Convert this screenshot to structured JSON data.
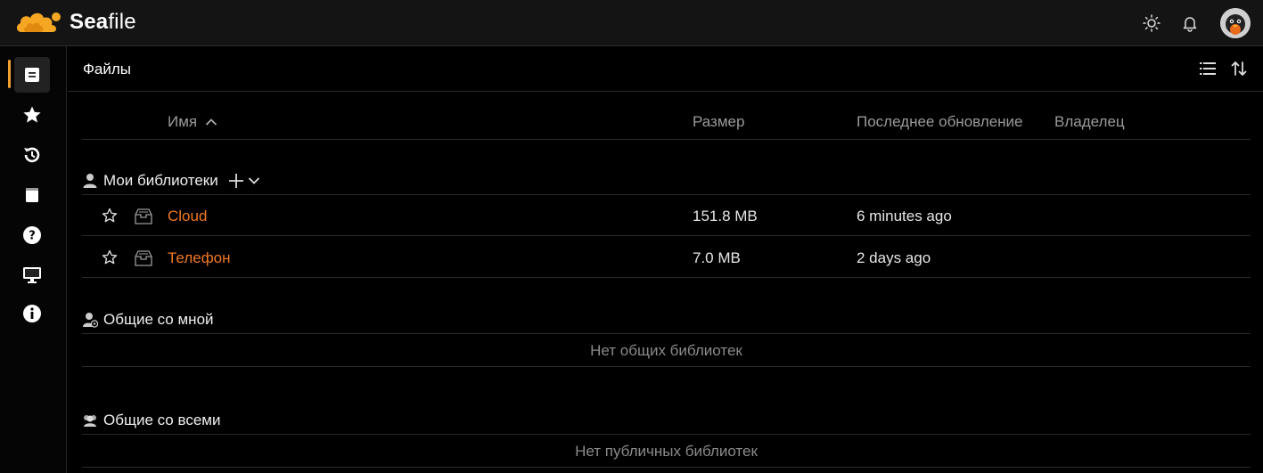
{
  "brand": {
    "logo_sea": "Sea",
    "logo_file": "file"
  },
  "header": {
    "icons": [
      "sun-icon",
      "bell-icon"
    ],
    "avatar": "avatar"
  },
  "sidenav": {
    "items": [
      {
        "name": "files",
        "icon": "document-icon",
        "active": true
      },
      {
        "name": "starred",
        "icon": "star-icon"
      },
      {
        "name": "activities",
        "icon": "history-icon"
      },
      {
        "name": "wikis",
        "icon": "book-icon"
      },
      {
        "name": "help",
        "icon": "help-icon"
      },
      {
        "name": "clients",
        "icon": "monitor-icon"
      },
      {
        "name": "about",
        "icon": "info-icon"
      }
    ],
    "accent": "#f0a030"
  },
  "main": {
    "title": "Файлы",
    "columns": {
      "name": "Имя",
      "size": "Размер",
      "updated": "Последнее обновление",
      "owner": "Владелец"
    },
    "my_libraries": {
      "label": "Мои библиотеки",
      "rows": [
        {
          "name": "Cloud",
          "size": "151.8 MB",
          "updated": "6 minutes ago"
        },
        {
          "name": "Телефон",
          "size": "7.0 MB",
          "updated": "2 days ago"
        }
      ]
    },
    "shared_with_me": {
      "label": "Общие со мной",
      "empty": "Нет общих библиотек"
    },
    "shared_with_all": {
      "label": "Общие со всеми",
      "empty": "Нет публичных библиотек"
    }
  },
  "colors": {
    "library_link": "#f07820",
    "background": "#000000",
    "accent": "#f0a030"
  }
}
